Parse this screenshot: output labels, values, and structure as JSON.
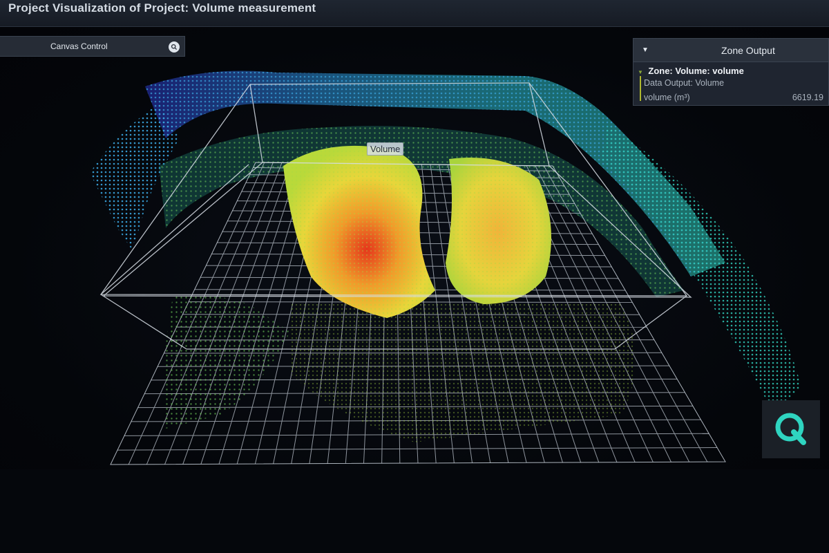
{
  "window": {
    "title": "Project Visualization of Project: Volume measurement"
  },
  "canvas_control": {
    "label": "Canvas Control",
    "search_icon": "search-icon"
  },
  "zone_output": {
    "header_title": "Zone Output",
    "zone_name": "Zone: Volume: volume",
    "data_output": "Data Output: Volume",
    "metric_label": "volume (m³)",
    "metric_value": "6619.19"
  },
  "scene": {
    "volume_tag": "Volume"
  },
  "logo": {
    "icon": "q-logo-icon",
    "color": "#2fd4c0"
  },
  "colors": {
    "background": "#05070d",
    "panel": "#1f2530",
    "grid": "#c9d1db",
    "points_low": "#2a3fbf",
    "points_mid": "#33c0c0",
    "points_high": "#e6d634",
    "points_peak": "#e03a1c"
  }
}
